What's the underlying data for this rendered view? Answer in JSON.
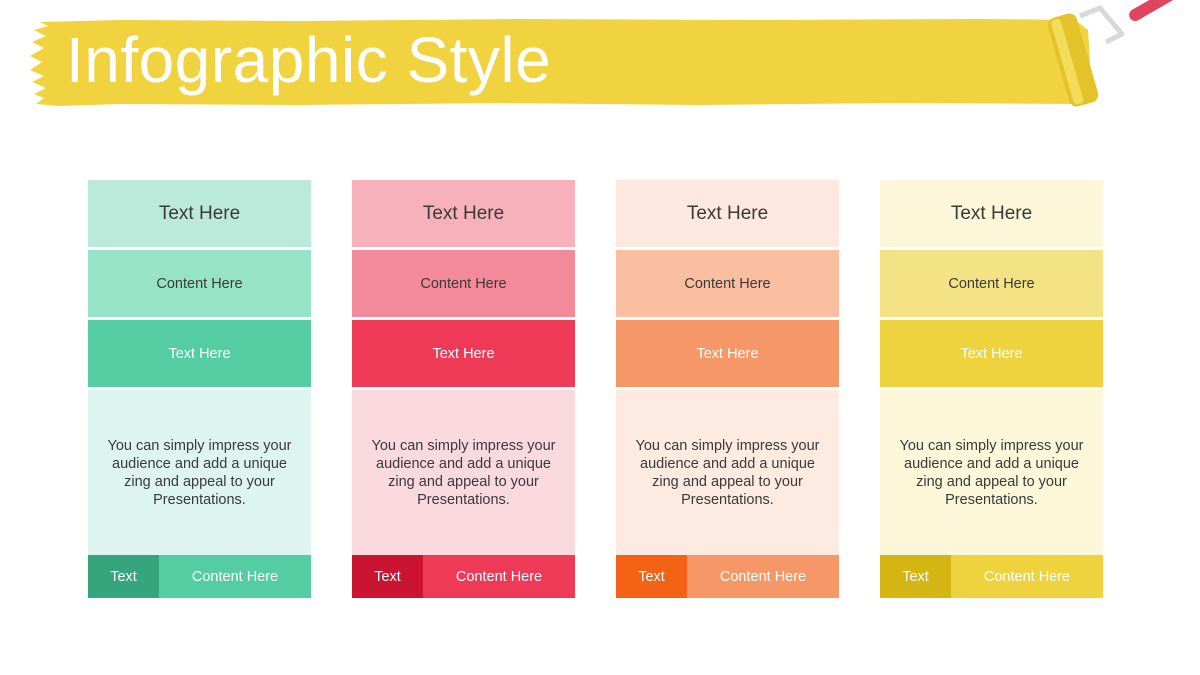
{
  "title": "Infographic Style",
  "colors": {
    "banner": "#F0D33F",
    "roller_handle": "#E04560",
    "roller_frame": "#D9D9D9"
  },
  "icons": {
    "paint_roller": "paint-roller-icon"
  },
  "columns": [
    {
      "header": "Text  Here",
      "content": "Content Here",
      "text": "Text Here",
      "body": "You can simply impress your audience and add a unique zing and appeal to your Presentations.",
      "foot_label": "Text",
      "foot_content": "Content Here",
      "colors": {
        "header": "#BCEADA",
        "content": "#97E3C8",
        "text": "#55CDA2",
        "body": "#DDF5EE",
        "foot_a": "#34A57C",
        "foot_b": "#55CDA2"
      }
    },
    {
      "header": "Text  Here",
      "content": "Content Here",
      "text": "Text Here",
      "body": "You can simply impress your audience and add a unique zing and appeal to your Presentations.",
      "foot_label": "Text",
      "foot_content": "Content Here",
      "colors": {
        "header": "#F7B1BB",
        "content": "#F38A99",
        "text": "#EE3A57",
        "body": "#FAD9DF",
        "foot_a": "#CB1432",
        "foot_b": "#EE3A57"
      }
    },
    {
      "header": "Text  Here",
      "content": "Content Here",
      "text": "Text Here",
      "body": "You can simply impress your audience and add a unique zing and appeal to your Presentations.",
      "foot_label": "Text",
      "foot_content": "Content Here",
      "colors": {
        "header": "#FDE9DF",
        "content": "#FABEA1",
        "text": "#F69767",
        "body": "#FDEBE2",
        "foot_a": "#F46216",
        "foot_b": "#F69767"
      }
    },
    {
      "header": "Text  Here",
      "content": "Content Here",
      "text": "Text Here",
      "body": "You can simply impress your audience and add a unique zing and appeal to your Presentations.",
      "foot_label": "Text",
      "foot_content": "Content Here",
      "colors": {
        "header": "#FCF7D9",
        "content": "#F4E384",
        "text": "#EFD33E",
        "body": "#FCF7D9",
        "foot_a": "#D5B514",
        "foot_b": "#EFD33E"
      }
    }
  ]
}
